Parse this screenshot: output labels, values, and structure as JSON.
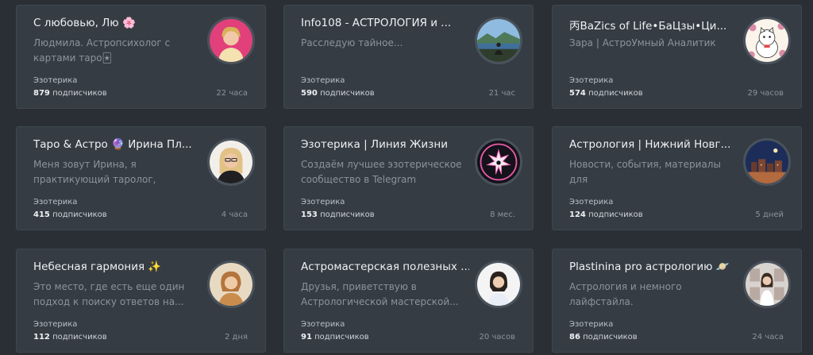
{
  "cards": [
    {
      "title": "С любовью, Лю",
      "emoji": "🌸",
      "desc": "Людмила. Астропсихолог с\nкартами таро🃏",
      "category": "Эзотерика",
      "subs_count": "879",
      "subs_label": "подписчиков",
      "time": "22 часа",
      "avatar": "woman-pink-background"
    },
    {
      "title": "Info108 - АСТРОЛОГИЯ и ...",
      "emoji": "",
      "desc": "Расследую тайное...",
      "category": "Эзотерика",
      "subs_count": "590",
      "subs_label": "подписчиков",
      "time": "21 час",
      "avatar": "person-mountain-lake"
    },
    {
      "title": "丙BaZics of Life•БаЦзы•Ци...",
      "emoji": "",
      "desc": "Зара | АстроУмный Аналитик",
      "category": "Эзотерика",
      "subs_count": "574",
      "subs_label": "подписчиков",
      "time": "29 часов",
      "avatar": "lucky-cat-illustration"
    },
    {
      "title": "Таро & Астро",
      "emoji": "🔮",
      "title_suffix": " Ирина Пл...",
      "desc": "Меня зовут Ирина, я\nпрактикующий таролог, астрол...",
      "category": "Эзотерика",
      "subs_count": "415",
      "subs_label": "подписчиков",
      "time": "4 часа",
      "avatar": "woman-blonde-glasses"
    },
    {
      "title": "Эзотерика | Линия Жизни",
      "emoji": "",
      "desc": "Создаём лучшее эзотерическое\nсообщество в Telegram",
      "category": "Эзотерика",
      "subs_count": "153",
      "subs_label": "подписчиков",
      "time": "8 мес.",
      "avatar": "pink-star-emblem"
    },
    {
      "title": "Астрология | Нижний Новг...",
      "emoji": "",
      "desc": "Новости, события, материалы для\nастрологов, любителей и...",
      "category": "Эзотерика",
      "subs_count": "124",
      "subs_label": "подписчиков",
      "time": "5 дней",
      "avatar": "city-night-skyline"
    },
    {
      "title": "Небесная гармония",
      "emoji": "✨",
      "desc": "Это место, где есть еще один\nподход к поиску ответов на...",
      "category": "Эзотерика",
      "subs_count": "112",
      "subs_label": "подписчиков",
      "time": "2 дня",
      "avatar": "woman-beige-portrait"
    },
    {
      "title": "Астромастерская полезных ...",
      "emoji": "",
      "desc": "Друзья, приветствую в\nАстрологической мастерской...",
      "category": "Эзотерика",
      "subs_count": "91",
      "subs_label": "подписчиков",
      "time": "20 часов",
      "avatar": "woman-dark-hair"
    },
    {
      "title": "Plastinina pro астрологию",
      "emoji": "🪐",
      "desc": "Астрология и немного\nлайфстайла.",
      "category": "Эзотерика",
      "subs_count": "86",
      "subs_label": "подписчиков",
      "time": "24 часа",
      "avatar": "woman-collage"
    }
  ]
}
